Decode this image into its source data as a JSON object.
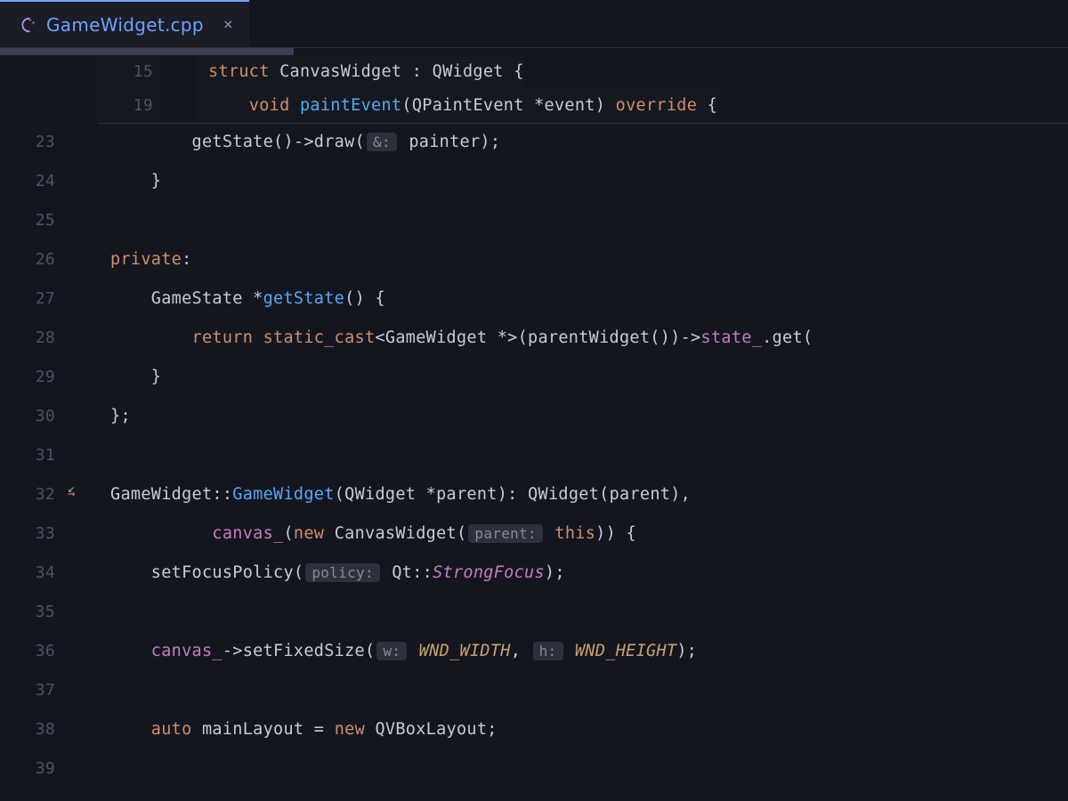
{
  "tab": {
    "filename": "GameWidget.cpp",
    "close_glyph": "×",
    "icon_color": "#b98df0"
  },
  "sticky": [
    {
      "num": "15",
      "tokens": [
        {
          "t": "struct ",
          "c": "kw"
        },
        {
          "t": "CanvasWidget ",
          "c": "ident"
        },
        {
          "t": ": ",
          "c": "op"
        },
        {
          "t": "QWidget ",
          "c": "ident"
        },
        {
          "t": "{",
          "c": "op"
        }
      ]
    },
    {
      "num": "19",
      "indent": 1,
      "tokens": [
        {
          "t": "void ",
          "c": "kw"
        },
        {
          "t": "paintEvent",
          "c": "fn"
        },
        {
          "t": "(",
          "c": "op"
        },
        {
          "t": "QPaintEvent ",
          "c": "ident"
        },
        {
          "t": "*",
          "c": "op"
        },
        {
          "t": "event",
          "c": "ident"
        },
        {
          "t": ") ",
          "c": "op"
        },
        {
          "t": "override ",
          "c": "kw"
        },
        {
          "t": "{",
          "c": "op"
        }
      ]
    }
  ],
  "lines": [
    {
      "num": "23",
      "indent": 2,
      "tokens": [
        {
          "t": "getState",
          "c": "ident"
        },
        {
          "t": "()->",
          "c": "op"
        },
        {
          "t": "draw",
          "c": "ident"
        },
        {
          "t": "(",
          "c": "op"
        },
        {
          "hint": "&:"
        },
        {
          "t": " painter",
          "c": "ident"
        },
        {
          "t": ");",
          "c": "op"
        }
      ]
    },
    {
      "num": "24",
      "indent": 1,
      "tokens": [
        {
          "t": "}",
          "c": "op"
        }
      ]
    },
    {
      "num": "25",
      "indent": 0,
      "tokens": []
    },
    {
      "num": "26",
      "indent": 0,
      "guide": true,
      "tokens": [
        {
          "t": "private",
          "c": "kw"
        },
        {
          "t": ":",
          "c": "op"
        }
      ]
    },
    {
      "num": "27",
      "indent": 1,
      "tokens": [
        {
          "t": "GameState ",
          "c": "ident"
        },
        {
          "t": "*",
          "c": "op"
        },
        {
          "t": "getState",
          "c": "fn"
        },
        {
          "t": "() {",
          "c": "op"
        }
      ]
    },
    {
      "num": "28",
      "indent": 2,
      "tokens": [
        {
          "t": "return ",
          "c": "kw"
        },
        {
          "t": "static_cast",
          "c": "kw"
        },
        {
          "t": "<",
          "c": "op"
        },
        {
          "t": "GameWidget ",
          "c": "ident"
        },
        {
          "t": "*>(",
          "c": "op"
        },
        {
          "t": "parentWidget",
          "c": "ident"
        },
        {
          "t": "())->",
          "c": "op"
        },
        {
          "t": "state_",
          "c": "field"
        },
        {
          "t": ".",
          "c": "op"
        },
        {
          "t": "get(",
          "c": "ident"
        }
      ]
    },
    {
      "num": "29",
      "indent": 1,
      "tokens": [
        {
          "t": "}",
          "c": "op"
        }
      ]
    },
    {
      "num": "30",
      "indent": 0,
      "guide": true,
      "tokens": [
        {
          "t": "};",
          "c": "op"
        }
      ]
    },
    {
      "num": "31",
      "indent": 0,
      "tokens": []
    },
    {
      "num": "32",
      "indent": 0,
      "marker": true,
      "tokens": [
        {
          "t": "GameWidget",
          "c": "ident"
        },
        {
          "t": "::",
          "c": "op"
        },
        {
          "t": "GameWidget",
          "c": "fn"
        },
        {
          "t": "(",
          "c": "op"
        },
        {
          "t": "QWidget ",
          "c": "ident"
        },
        {
          "t": "*",
          "c": "op"
        },
        {
          "t": "parent",
          "c": "ident"
        },
        {
          "t": "): ",
          "c": "op"
        },
        {
          "t": "QWidget",
          "c": "ident"
        },
        {
          "t": "(",
          "c": "op"
        },
        {
          "t": "parent",
          "c": "ident"
        },
        {
          "t": "),",
          "c": "op"
        }
      ]
    },
    {
      "num": "33",
      "indent": 0,
      "pad": "          ",
      "guide": true,
      "tokens": [
        {
          "t": "canvas_",
          "c": "field"
        },
        {
          "t": "(",
          "c": "op"
        },
        {
          "t": "new ",
          "c": "kw"
        },
        {
          "t": "CanvasWidget",
          "c": "ident"
        },
        {
          "t": "(",
          "c": "op"
        },
        {
          "hint": "parent:"
        },
        {
          "t": " ",
          "c": "op"
        },
        {
          "t": "this",
          "c": "kw"
        },
        {
          "t": ")) {",
          "c": "op"
        }
      ]
    },
    {
      "num": "34",
      "indent": 1,
      "tokens": [
        {
          "t": "setFocusPolicy",
          "c": "ident"
        },
        {
          "t": "(",
          "c": "op"
        },
        {
          "hint": "policy:"
        },
        {
          "t": " Qt::",
          "c": "ident"
        },
        {
          "t": "StrongFocus",
          "c": "field",
          "italic": true
        },
        {
          "t": ");",
          "c": "op"
        }
      ]
    },
    {
      "num": "35",
      "indent": 0,
      "guide": true,
      "tokens": []
    },
    {
      "num": "36",
      "indent": 1,
      "tokens": [
        {
          "t": "canvas_",
          "c": "field"
        },
        {
          "t": "->",
          "c": "op"
        },
        {
          "t": "setFixedSize",
          "c": "ident"
        },
        {
          "t": "(",
          "c": "op"
        },
        {
          "hint": "w:"
        },
        {
          "t": " ",
          "c": "op"
        },
        {
          "t": "WND_WIDTH",
          "c": "const-y"
        },
        {
          "t": ", ",
          "c": "op"
        },
        {
          "hint": "h:"
        },
        {
          "t": " ",
          "c": "op"
        },
        {
          "t": "WND_HEIGHT",
          "c": "const-y"
        },
        {
          "t": ");",
          "c": "op"
        }
      ]
    },
    {
      "num": "37",
      "indent": 0,
      "guide": true,
      "tokens": []
    },
    {
      "num": "38",
      "indent": 1,
      "tokens": [
        {
          "t": "auto ",
          "c": "kw"
        },
        {
          "t": "mainLayout ",
          "c": "ident"
        },
        {
          "t": "= ",
          "c": "op"
        },
        {
          "t": "new ",
          "c": "kw"
        },
        {
          "t": "QVBoxLayout",
          "c": "ident"
        },
        {
          "t": ";",
          "c": "op"
        }
      ]
    },
    {
      "num": "39",
      "indent": 0,
      "guide": true,
      "tokens": []
    }
  ],
  "indent_unit": "    ",
  "colors": {
    "bg": "#14161f",
    "accent": "#6ea3ff",
    "keyword": "#cf8e6d",
    "function": "#56a8f5",
    "field": "#c77dbb",
    "text": "#c8ccd4",
    "gutter": "#4b5162"
  }
}
